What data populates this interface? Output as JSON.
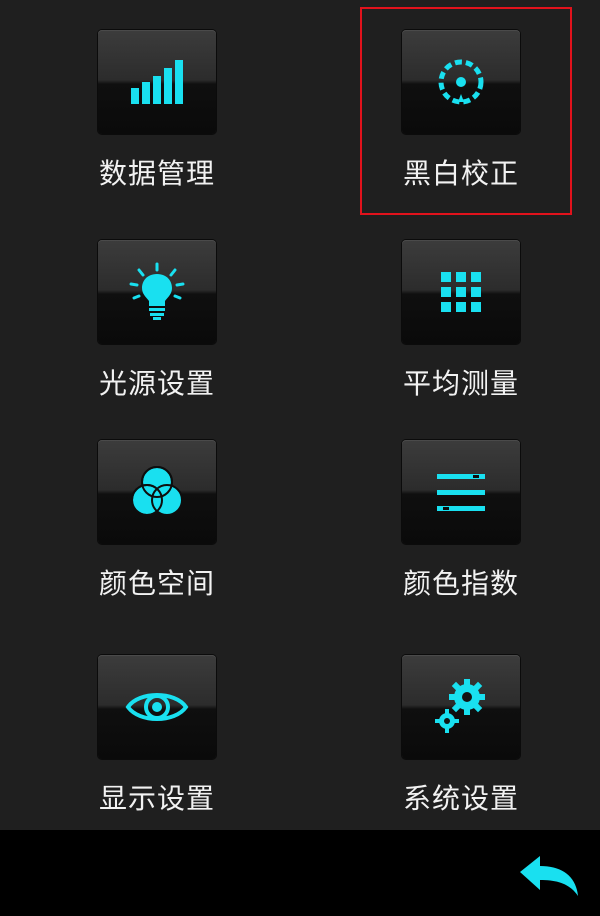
{
  "accent_color": "#19e0f0",
  "highlight_color": "#e1121c",
  "menu": {
    "items": [
      {
        "label": "数据管理",
        "icon": "signal-bars-icon"
      },
      {
        "label": "黑白校正",
        "icon": "calibration-dial-icon",
        "selected": true
      },
      {
        "label": "光源设置",
        "icon": "lightbulb-icon"
      },
      {
        "label": "平均测量",
        "icon": "grid-icon"
      },
      {
        "label": "颜色空间",
        "icon": "color-circles-icon"
      },
      {
        "label": "颜色指数",
        "icon": "lines-icon"
      },
      {
        "label": "显示设置",
        "icon": "eye-icon"
      },
      {
        "label": "系统设置",
        "icon": "gears-icon"
      }
    ]
  },
  "bottom_bar": {
    "back_icon": "back-arrow-icon"
  }
}
